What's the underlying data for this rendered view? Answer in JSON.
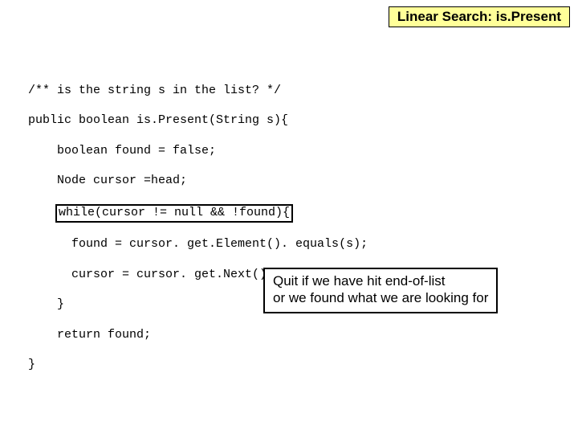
{
  "title": "Linear Search: is.Present",
  "code": {
    "l1": "/** is the string s in the list? */",
    "l2": "public boolean is.Present(String s){",
    "l3": "    boolean found = false;",
    "l4": "    Node cursor =head;",
    "l5_prefix": "    ",
    "l5_box": "while(cursor != null && !found){",
    "l6": "      found = cursor. get.Element(). equals(s);",
    "l7": "      cursor = cursor. get.Next();",
    "l8": "    }",
    "l9": "    return found;",
    "l10": "}"
  },
  "note": {
    "line1": "Quit if we have hit end-of-list",
    "line2": "or we found what we are looking for"
  }
}
